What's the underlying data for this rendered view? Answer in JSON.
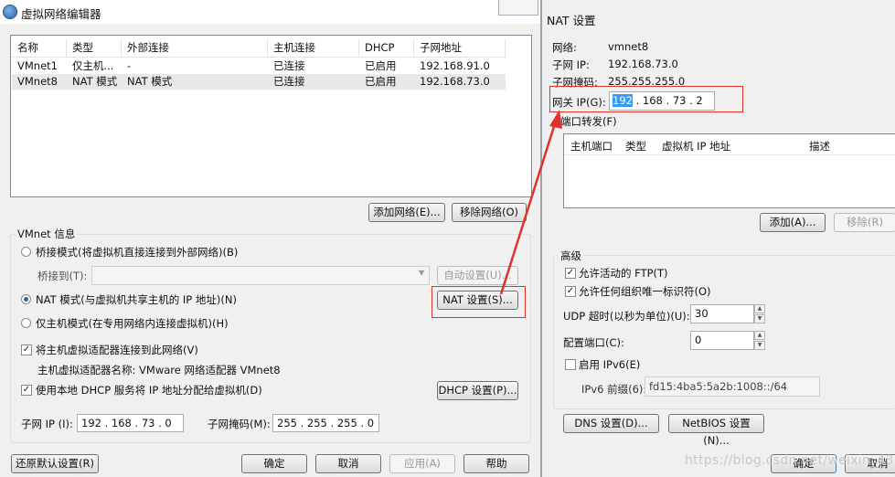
{
  "editor": {
    "title": "虚拟网络编辑器",
    "columns": [
      "名称",
      "类型",
      "外部连接",
      "主机连接",
      "DHCP",
      "子网地址"
    ],
    "rows": [
      {
        "name": "VMnet1",
        "type": "仅主机...",
        "external": "-",
        "host": "已连接",
        "dhcp": "已启用",
        "subnet": "192.168.91.0"
      },
      {
        "name": "VMnet8",
        "type": "NAT 模式",
        "external": "NAT 模式",
        "host": "已连接",
        "dhcp": "已启用",
        "subnet": "192.168.73.0"
      }
    ],
    "add_network": "添加网络(E)...",
    "remove_network": "移除网络(O)",
    "vmnet_info": "VMnet 信息",
    "bridge_mode": "桥接模式(将虚拟机直接连接到外部网络)(B)",
    "bridge_to_label": "桥接到(T):",
    "bridge_to_value": "",
    "auto_settings": "自动设置(U)...",
    "nat_mode": "NAT 模式(与虚拟机共享主机的 IP 地址)(N)",
    "nat_settings": "NAT 设置(S)...",
    "host_only_mode": "仅主机模式(在专用网络内连接虚拟机)(H)",
    "connect_host_adapter": "将主机虚拟适配器连接到此网络(V)",
    "host_adapter_name": "主机虚拟适配器名称: VMware 网络适配器 VMnet8",
    "use_dhcp": "使用本地 DHCP 服务将 IP 地址分配给虚拟机(D)",
    "dhcp_settings": "DHCP 设置(P)...",
    "subnet_ip_label": "子网 IP (I):",
    "subnet_ip": "192 . 168 . 73 . 0",
    "subnet_mask_label": "子网掩码(M):",
    "subnet_mask": "255 . 255 . 255 . 0",
    "restore_defaults": "还原默认设置(R)",
    "ok": "确定",
    "cancel": "取消",
    "apply": "应用(A)",
    "help": "帮助"
  },
  "nat": {
    "title": "NAT 设置",
    "network_label": "网络:",
    "network_value": "vmnet8",
    "subnet_ip_label": "子网 IP:",
    "subnet_ip_value": "192.168.73.0",
    "subnet_mask_label": "子网掩码:",
    "subnet_mask_value": "255.255.255.0",
    "gateway_label": "网关 IP(G):",
    "gateway_first": "192",
    "gateway_rest": " . 168 . 73 . 2",
    "port_forward_label": "端口转发(F)",
    "port_columns": [
      "主机端口",
      "类型",
      "虚拟机 IP 地址",
      "描述"
    ],
    "add": "添加(A)...",
    "remove": "移除(R)",
    "advanced": "高级",
    "allow_ftp": "允许活动的 FTP(T)",
    "allow_org_id": "允许任何组织唯一标识符(O)",
    "udp_timeout_label": "UDP 超时(以秒为单位)(U):",
    "udp_timeout_value": "30",
    "config_port_label": "配置端口(C):",
    "config_port_value": "0",
    "enable_ipv6": "启用 IPv6(E)",
    "ipv6_prefix_label": "IPv6 前缀(6):",
    "ipv6_prefix_value": "fd15:4ba5:5a2b:1008::/64",
    "dns_settings": "DNS 设置(D)...",
    "netbios_settings": "NetBIOS 设置(N)...",
    "ok": "确定",
    "cancel": "取消"
  },
  "watermark": "https://blog.csdn.net/weixin_4374...",
  "colors": {
    "annotation": "#e0312b",
    "selection": "#3399ff"
  }
}
